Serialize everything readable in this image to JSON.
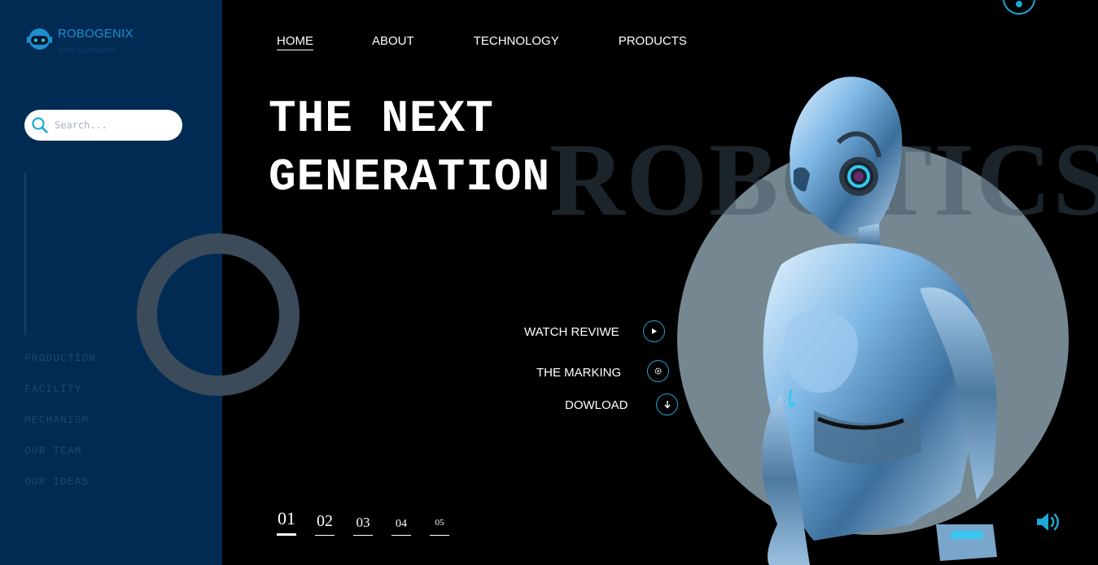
{
  "brand": {
    "name": "ROBOGENIX",
    "tagline": "Next Generation"
  },
  "search": {
    "placeholder": "Search..."
  },
  "sidebar": {
    "menu": [
      {
        "label": "PRODUCTION"
      },
      {
        "label": "FACILITY"
      },
      {
        "label": "MECHANISM"
      },
      {
        "label": "OUR TEAM"
      },
      {
        "label": "OUR IDEAS"
      }
    ]
  },
  "nav": [
    {
      "label": "HOME",
      "active": true
    },
    {
      "label": "ABOUT"
    },
    {
      "label": "TECHNOLOGY"
    },
    {
      "label": "PRODUCTS"
    }
  ],
  "hero": {
    "line1": "THE NEXT",
    "line2": "GENERATION",
    "background_word": "ROBOTICS"
  },
  "actions": [
    {
      "label": "WATCH REVIWE",
      "icon": "play-icon"
    },
    {
      "label": "THE MARKING",
      "icon": "gear-icon"
    },
    {
      "label": "DOWLOAD",
      "icon": "download-icon"
    }
  ],
  "pager": [
    {
      "label": "01",
      "active": true
    },
    {
      "label": "02"
    },
    {
      "label": "03"
    },
    {
      "label": "04"
    },
    {
      "label": "05"
    }
  ],
  "colors": {
    "sidebar_bg": "#022b54",
    "accent": "#1ba9d6",
    "page_bg": "#000000",
    "hero_circle": "#758791"
  }
}
